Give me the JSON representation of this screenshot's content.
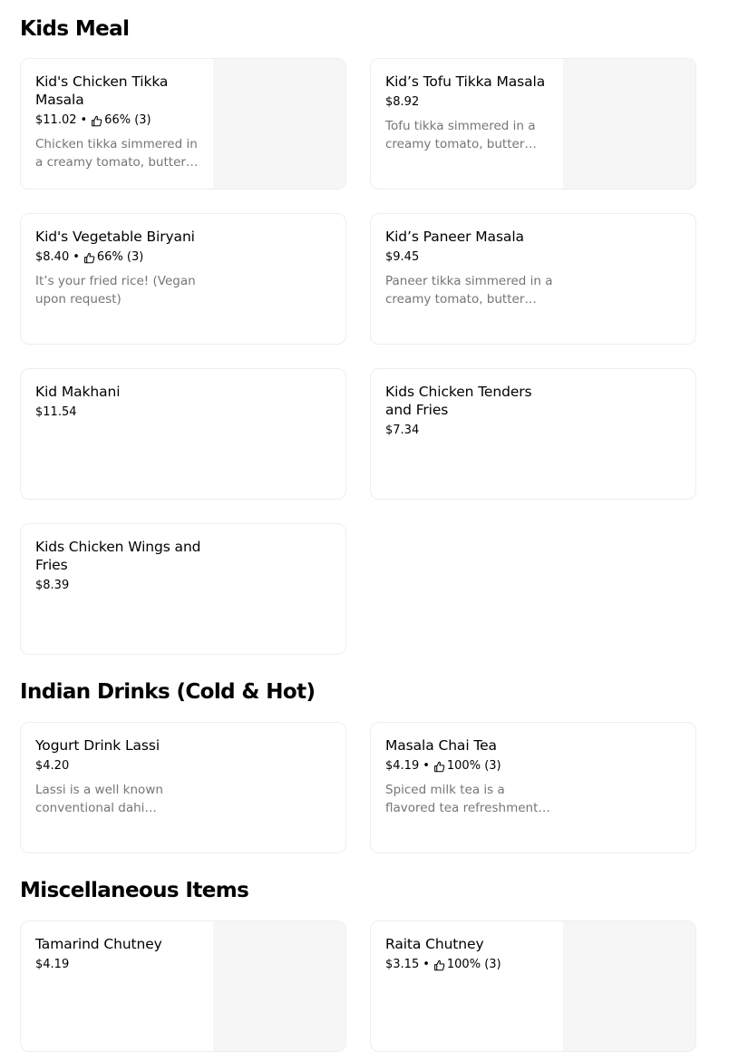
{
  "sections": [
    {
      "title": "Kids Meal"
    },
    {
      "title": "Indian Drinks (Cold & Hot)"
    },
    {
      "title": "Miscellaneous Items"
    }
  ],
  "items": [
    {
      "name": "Kid's Chicken Tikka Masala",
      "price": "$11.02",
      "rating": "66% (3)",
      "description": "Chicken tikka simmered in a creamy tomato, butter…",
      "has_image": true
    },
    {
      "name": "Kid’s Tofu Tikka Masala",
      "price": "$8.92",
      "rating": "",
      "description": "Tofu tikka simmered in a creamy tomato, butter…",
      "has_image": true
    },
    {
      "name": "Kid's Vegetable Biryani",
      "price": "$8.40",
      "rating": "66% (3)",
      "description": "It’s your fried rice! (Vegan upon request)",
      "has_image": false
    },
    {
      "name": "Kid’s Paneer Masala",
      "price": "$9.45",
      "rating": "",
      "description": "Paneer tikka simmered in a creamy tomato, butter…",
      "has_image": false
    },
    {
      "name": "Kid Makhani",
      "price": "$11.54",
      "rating": "",
      "description": "",
      "has_image": false
    },
    {
      "name": "Kids Chicken Tenders and Fries",
      "price": "$7.34",
      "rating": "",
      "description": "",
      "has_image": false
    },
    {
      "name": "Kids Chicken Wings and Fries",
      "price": "$8.39",
      "rating": "",
      "description": "",
      "has_image": false
    },
    {
      "name": "Yogurt Drink Lassi",
      "price": "$4.20",
      "rating": "",
      "description": "Lassi is a well known conventional dahi (yogurt)…",
      "has_image": false
    },
    {
      "name": "Masala Chai Tea",
      "price": "$4.19",
      "rating": "100% (3)",
      "description": "Spiced milk tea is a flavored tea refreshment made by…",
      "has_image": false
    },
    {
      "name": "Tamarind Chutney",
      "price": "$4.19",
      "rating": "",
      "description": "",
      "has_image": true
    },
    {
      "name": "Raita Chutney",
      "price": "$3.15",
      "rating": "100% (3)",
      "description": "",
      "has_image": true
    }
  ],
  "icons": {
    "rating": "thumbs-up-icon"
  },
  "colors": {
    "text": "#000000",
    "muted": "#757575",
    "border": "#eeeeee",
    "image_placeholder": "#f6f6f6"
  }
}
